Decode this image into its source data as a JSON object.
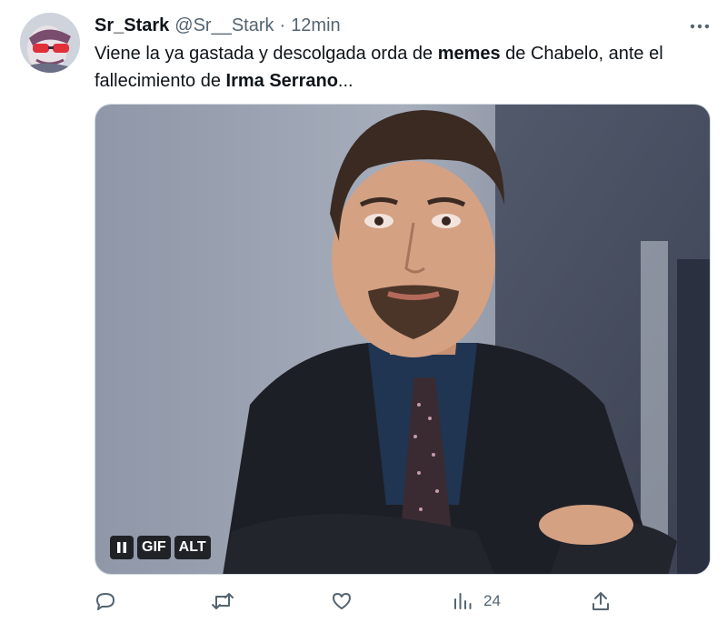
{
  "tweet": {
    "author": {
      "display_name": "Sr_Stark",
      "handle": "@Sr__Stark",
      "separator": "·",
      "time": "12min"
    },
    "text": {
      "part1": "Viene la ya gastada y descolgada orda de ",
      "bold1": "memes",
      "part2": " de Chabelo, ante el fallecimiento de ",
      "bold2": "Irma Serrano",
      "part3": "..."
    },
    "media": {
      "type": "gif",
      "gif_label": "GIF",
      "alt_label": "ALT",
      "pause_icon": "pause-icon"
    },
    "actions": {
      "reply_icon": "reply-icon",
      "retweet_icon": "retweet-icon",
      "like_icon": "like-icon",
      "views_icon": "views-icon",
      "views_count": "24",
      "share_icon": "share-icon"
    }
  },
  "colors": {
    "text_primary": "#0f1419",
    "text_secondary": "#536471",
    "border": "#cfd9de"
  }
}
